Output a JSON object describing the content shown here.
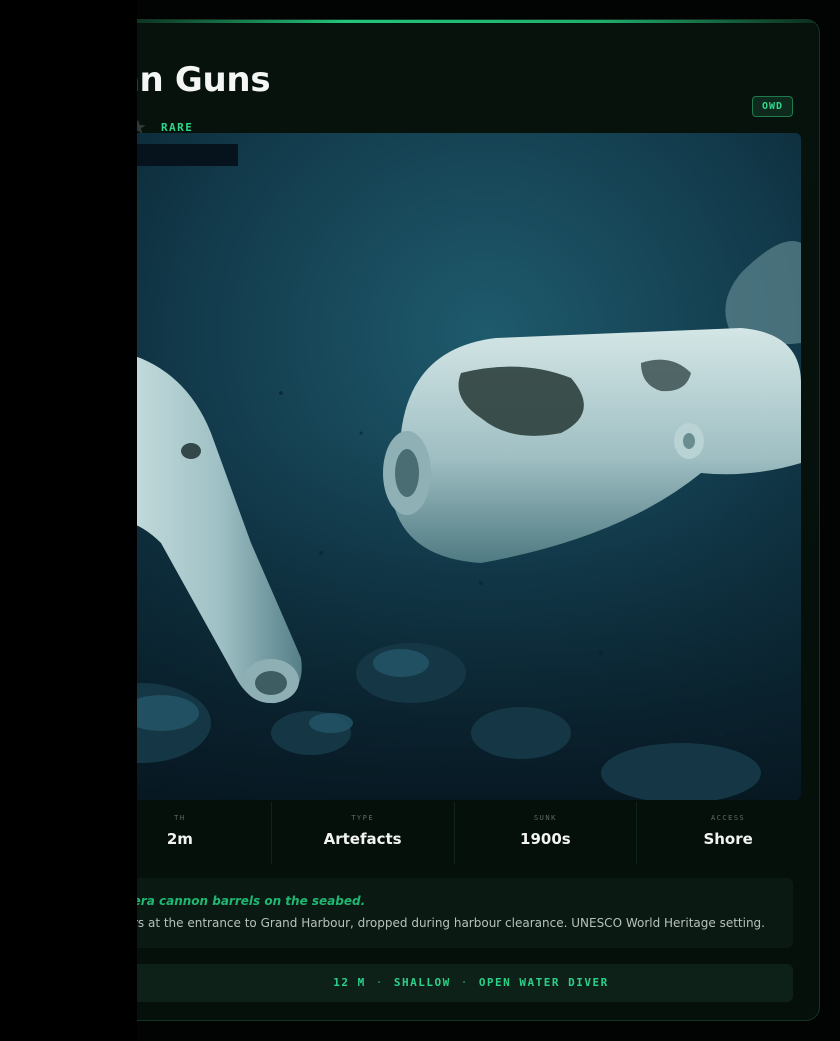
{
  "title": "rian Guns",
  "rarity": "RARE",
  "badge": "OWD",
  "stats": [
    {
      "label": "TH",
      "value": "2m"
    },
    {
      "label": "TYPE",
      "value": "Artefacts"
    },
    {
      "label": "SUNK",
      "value": "1900s"
    },
    {
      "label": "ACCESS",
      "value": "Shore"
    }
  ],
  "description": {
    "headline": "rian-era cannon barrels on the seabed.",
    "body": "e Loaders at the entrance to Grand Harbour, dropped during harbour clearance. UNESCO World Heritage setting."
  },
  "footer": {
    "depth": "12 M",
    "level": "SHALLOW",
    "certification": "OPEN WATER DIVER"
  },
  "icons": {
    "rating": "star-icon"
  },
  "colors": {
    "accent": "#2fd58a",
    "card_border": "#143526",
    "background": "#020403"
  }
}
